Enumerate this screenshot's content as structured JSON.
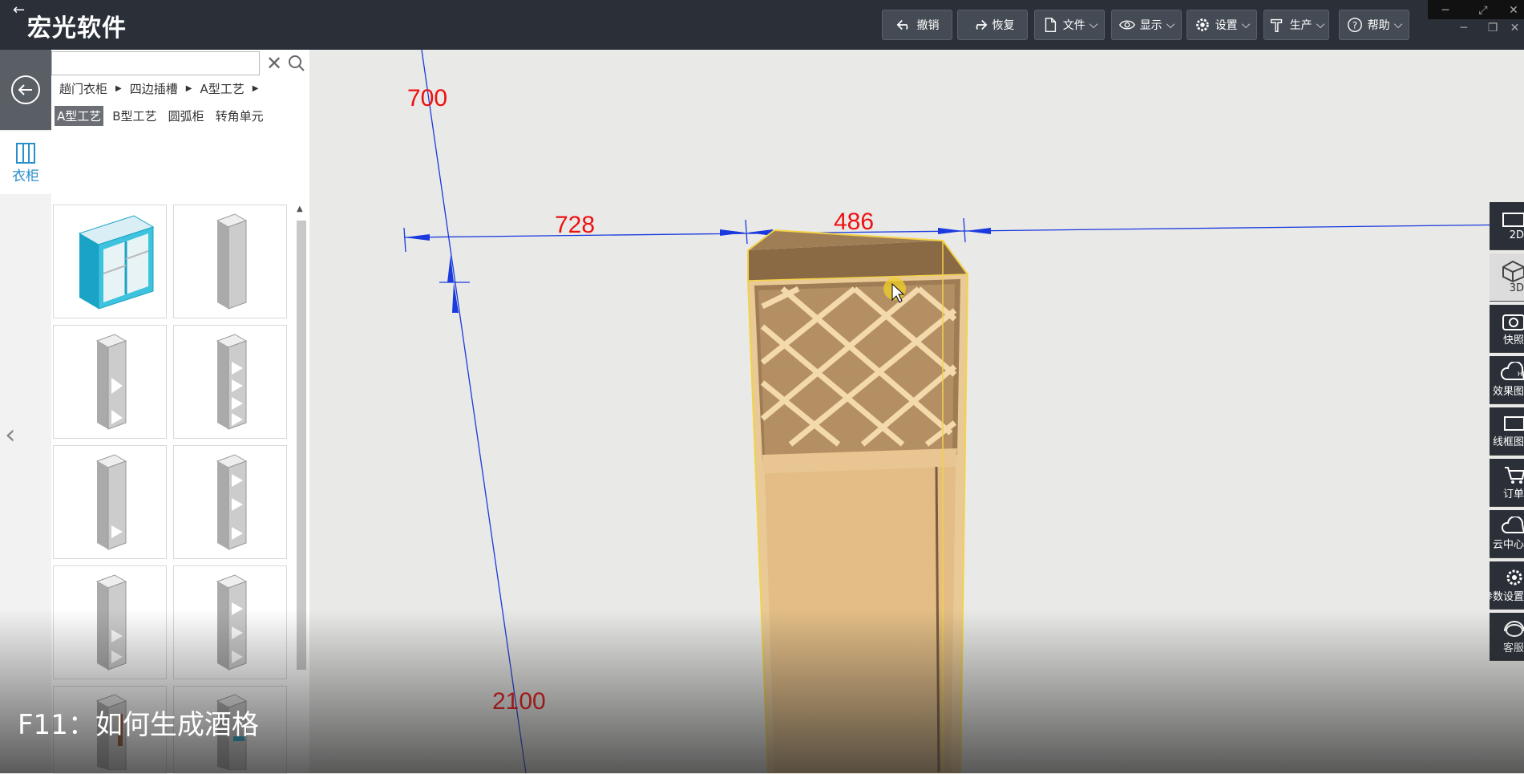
{
  "app": {
    "title": "宏光软件"
  },
  "toolbar": {
    "undo": "撤销",
    "redo": "恢复",
    "file": "文件",
    "display": "显示",
    "settings": "设置",
    "production": "生产",
    "help": "帮助"
  },
  "leftnav": {
    "wardrobe": "衣柜"
  },
  "panel": {
    "search_placeholder": "",
    "breadcrumbs": [
      "趟门衣柜",
      "四边插槽",
      "A型工艺"
    ],
    "subtabs": [
      "A型工艺",
      "B型工艺",
      "圆弧柜",
      "转角单元"
    ],
    "active_subtab": "A型工艺"
  },
  "viewport": {
    "dimensions": [
      "700",
      "728",
      "486",
      "2100"
    ]
  },
  "rightbar": {
    "items": [
      "2D",
      "3D",
      "快照",
      "效果图",
      "线框图",
      "订单",
      "云中心",
      "参数设置",
      "客服"
    ],
    "active": "3D"
  },
  "caption": "F11：如何生成酒格",
  "colors": {
    "accent": "#2a8ecb",
    "dimension": "#e11111",
    "highlight": "#f3d24a"
  }
}
